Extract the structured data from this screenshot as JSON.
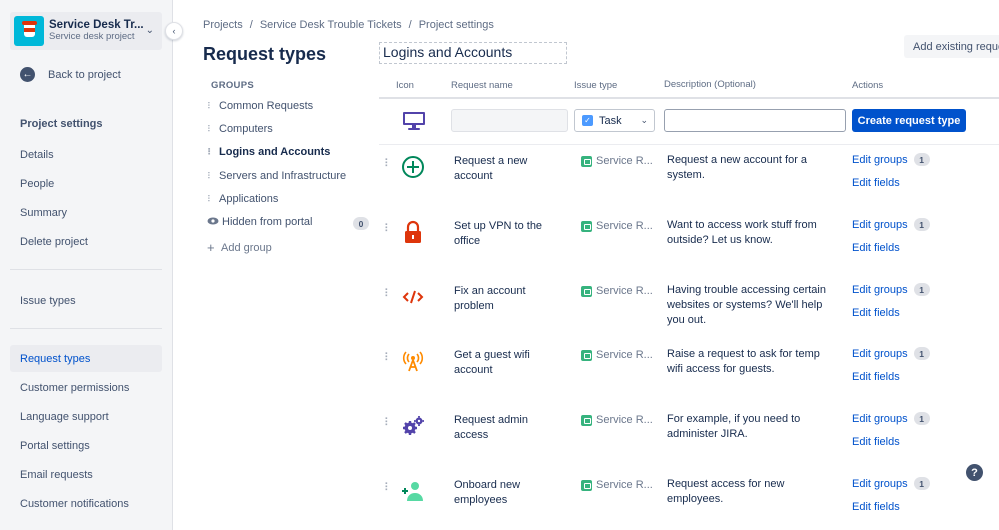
{
  "sidebar": {
    "project_name": "Service Desk Tr...",
    "project_type": "Service desk project",
    "back_label": "Back to project",
    "heading": "Project settings",
    "items_top": [
      "Details",
      "People",
      "Summary",
      "Delete project"
    ],
    "issue_types": "Issue types",
    "items_bottom": [
      "Request types",
      "Customer permissions",
      "Language support",
      "Portal settings",
      "Email requests",
      "Customer notifications"
    ]
  },
  "breadcrumb": [
    "Projects",
    "/",
    "Service Desk Trouble Tickets",
    "/",
    "Project settings"
  ],
  "page_title": "Request types",
  "groups": {
    "heading": "GROUPS",
    "items": [
      "Common Requests",
      "Computers",
      "Logins and Accounts",
      "Servers and Infrastructure",
      "Applications"
    ],
    "hidden_label": "Hidden from portal",
    "hidden_count": "0",
    "add_label": "Add group"
  },
  "group_title": "Logins and Accounts",
  "add_existing": "Add existing request type",
  "table": {
    "headers": {
      "icon": "Icon",
      "name": "Request name",
      "issue_type": "Issue type",
      "description": "Description",
      "description_hint": "(Optional)",
      "actions": "Actions"
    },
    "create": {
      "issue_type": "Task",
      "button": "Create request type"
    },
    "edit_groups_label": "Edit groups",
    "edit_fields_label": "Edit fields",
    "rows": [
      {
        "icon": "plus-circle-icon",
        "name": "Request a new account",
        "issue_type": "Service R...",
        "description": "Request a new account for a system.",
        "groups": "1"
      },
      {
        "icon": "lock-icon",
        "name": "Set up VPN to the office",
        "issue_type": "Service R...",
        "description": "Want to access work stuff from outside? Let us know.",
        "groups": "1"
      },
      {
        "icon": "code-icon",
        "name": "Fix an account problem",
        "issue_type": "Service R...",
        "description": "Having trouble accessing certain websites or systems? We'll help you out.",
        "groups": "1"
      },
      {
        "icon": "wifi-antenna-icon",
        "name": "Get a guest wifi account",
        "issue_type": "Service R...",
        "description": "Raise a request to ask for temp wifi access for guests.",
        "groups": "1"
      },
      {
        "icon": "gears-icon",
        "name": "Request admin access",
        "issue_type": "Service R...",
        "description": "For example, if you need to administer JIRA.",
        "groups": "1"
      },
      {
        "icon": "add-user-icon",
        "name": "Onboard new employees",
        "issue_type": "Service R...",
        "description": "Request access for new employees.",
        "groups": "1"
      }
    ]
  },
  "help": "?"
}
